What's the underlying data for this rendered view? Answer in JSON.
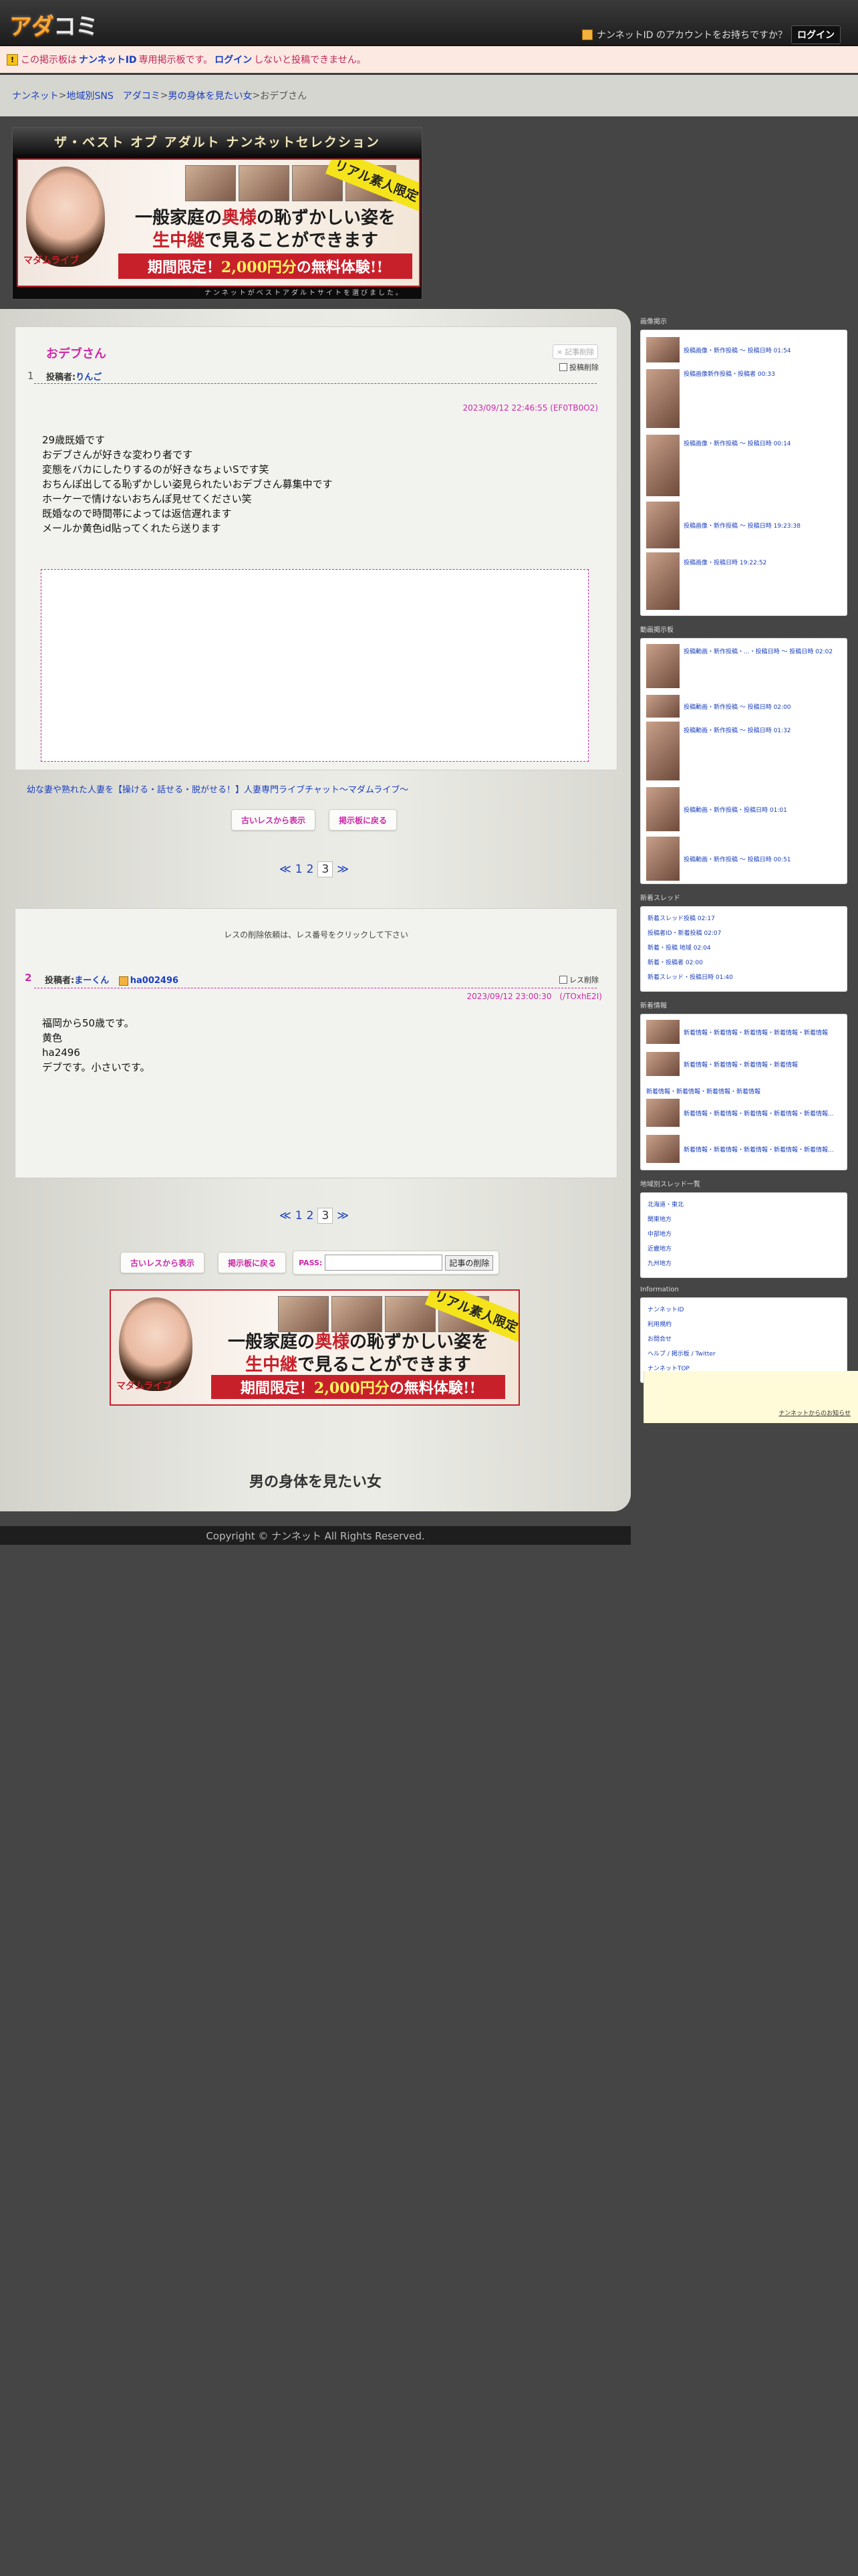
{
  "header": {
    "logo": [
      "アダ",
      "コミ"
    ],
    "account_question": "ナンネットID のアカウントをお持ちですか？",
    "login_button": "ログイン"
  },
  "warning": {
    "pre": "この掲示板は",
    "id_link": "ナンネットID",
    "mid": "専用掲示板です。",
    "login_link": "ログイン",
    "post": "しないと投稿できません。"
  },
  "breadcrumb": {
    "items": [
      "ナンネット",
      "地域別SNS　アダコミ",
      "男の身体を見たい女"
    ],
    "current": "おデブさん",
    "sep": " > "
  },
  "banner": {
    "top_text": "ザ・ベスト オブ アダルト ナンネットセレクション",
    "ribbon": "リアル素人限定",
    "line1_a": "一般家庭の",
    "line1_b": "奥様",
    "line1_c": "の恥ずかしい姿を",
    "line2_a": "生中継",
    "line2_b": "で見ることができます",
    "line3_a": "期間限定！",
    "line3_b": "2,000円分",
    "line3_c": "の無料体験!!",
    "sign": "マダムライブ",
    "bottom_text": "ナンネットがベストアダルトサイトを選びました。"
  },
  "thread": {
    "title": "おデブさん",
    "delete_btn": "記事削除",
    "delete_check": "投稿削除",
    "post1": {
      "num": "1",
      "author_label": "投稿者:",
      "author": "りんご",
      "date": "2023/09/12 22:46:55 (EF0TB0O2)",
      "lines": [
        "29歳既婚です",
        "おデブさんが好きな変わり者です",
        "変態をバカにしたりするのが好きなちょいSです笑",
        "おちんぽ出してる恥ずかしい姿見られたいおデブさん募集中です",
        "ホーケーで情けないおちんぽ見せてください笑",
        "既婚なので時間帯によっては返信遅れます",
        "メールか黄色id貼ってくれたら送ります"
      ]
    },
    "ad_link": "幼な妻や熟れた人妻を【操ける・話せる・脱がせる！】人妻専門ライブチャット〜マダムライブ〜",
    "older_btn": "古いレスから表示",
    "back_btn": "掲示板に戻る",
    "pager": {
      "prev": "≪",
      "pages": [
        "1",
        "2"
      ],
      "current": "3",
      "next": "≫"
    },
    "res_notice": "レスの削除依頼は、レス番号をクリックして下さい",
    "post2": {
      "num": "2",
      "author_label": "投稿者:",
      "author": "まーくん",
      "id_link": "ha002496",
      "check": "レス削除",
      "date": "2023/09/12 23:00:30　(/TOxhE2I)",
      "lines": [
        "福岡から50歳です。",
        "黄色",
        "ha2496",
        "デブです。小さいです。"
      ]
    },
    "pass_label": "PASS:",
    "pass_value": "",
    "delete_article": "記事の削除",
    "board_name": "男の身体を見たい女"
  },
  "footer": "Copyright © ナンネット All Rights Reserved.",
  "sidebar": {
    "sec1_title": "画像掲示",
    "sec1": [
      "投稿画像・新作投稿 ～ 投稿日時 01:54",
      "投稿画像新作投稿・投稿者 00:33",
      "投稿画像・新作投稿 ～ 投稿日時 00:14",
      "投稿画像・新作投稿 ～ 投稿日時 19:23:38",
      "投稿画像・投稿日時 19:22:52"
    ],
    "sec2_title": "動画掲示板",
    "sec2": [
      "投稿動画・新作投稿・...・投稿日時 ～ 投稿日時 02:02",
      "投稿動画・新作投稿 ～ 投稿日時 02:00",
      "投稿動画・新作投稿 ～ 投稿日時 01:32",
      "投稿動画・新作投稿・投稿日時 01:01",
      "投稿動画・新作投稿 ～ 投稿日時 00:51"
    ],
    "sec3_title": "新着スレッド",
    "sec3": [
      "新着スレッド投稿 02:17",
      "投稿者ID・新着投稿 02:07",
      "新着・投稿 地域 02:04",
      "新着・投稿者 02:00",
      "新着スレッド・投稿日時 01:40"
    ],
    "sec4_title": "新着情報",
    "sec4": [
      "新着情報・新着情報・新着情報・新着情報・新着情報",
      "新着情報・新着情報・新着情報・新着情報",
      "新着情報・新着情報・新着情報・新着情報",
      "新着情報・新着情報・新着情報・新着情報・新着情報...",
      "新着情報・新着情報・新着情報・新着情報・新着情報..."
    ],
    "sec5_title": "地域別スレッド一覧",
    "sec5": [
      "北海道・東北",
      "関東地方",
      "中部地方",
      "近畿地方",
      "九州地方"
    ],
    "sec6_title": "Information",
    "sec6": [
      "ナンネットID",
      "利用規約",
      "お問合せ",
      "ヘルプ / 掲示板 / Twitter",
      "ナンネットTOP"
    ],
    "note_link": "ナンネットからのお知らせ"
  }
}
